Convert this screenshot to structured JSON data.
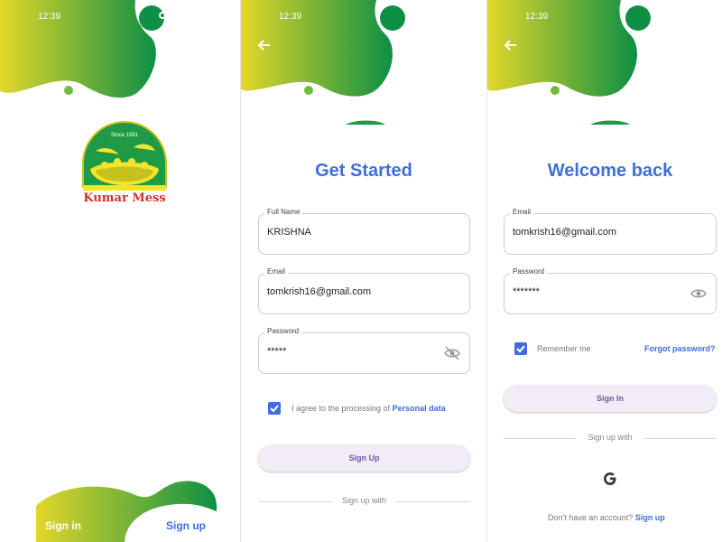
{
  "splash": {
    "time": "12:39",
    "logo_tagline": "Since 1981",
    "logo_name": "Kumar Mess",
    "tab_signin": "Sign in",
    "tab_signup": "Sign up"
  },
  "signup": {
    "time": "12:39",
    "title": "Get Started",
    "full_name_label": "Full Name",
    "full_name_value": "KRISHNA",
    "email_label": "Email",
    "email_value": "tomkrish16@gmail.com",
    "password_label": "Password",
    "password_value": "*****",
    "agree_text": "I agree to the processing of",
    "agree_link": "Personal data",
    "agree_checked": true,
    "button_label": "Sign Up",
    "separator_text": "Sign up with"
  },
  "signin": {
    "time": "12:39",
    "title": "Welcome back",
    "email_label": "Email",
    "email_value": "tomkrish16@gmail.com",
    "password_label": "Password",
    "password_value": "*******",
    "remember_label": "Remember me",
    "remember_checked": true,
    "forgot_link": "Forgot password?",
    "button_label": "Sign In",
    "separator_text": "Sign up with",
    "social_icon": "google-icon",
    "footer_text": "Don't have an account?",
    "footer_link": "Sign up"
  },
  "colors": {
    "accent": "#3f6fd6",
    "gradient_start": "#e3d72a",
    "gradient_end": "#0d8f44",
    "logo_red": "#d0312d"
  }
}
